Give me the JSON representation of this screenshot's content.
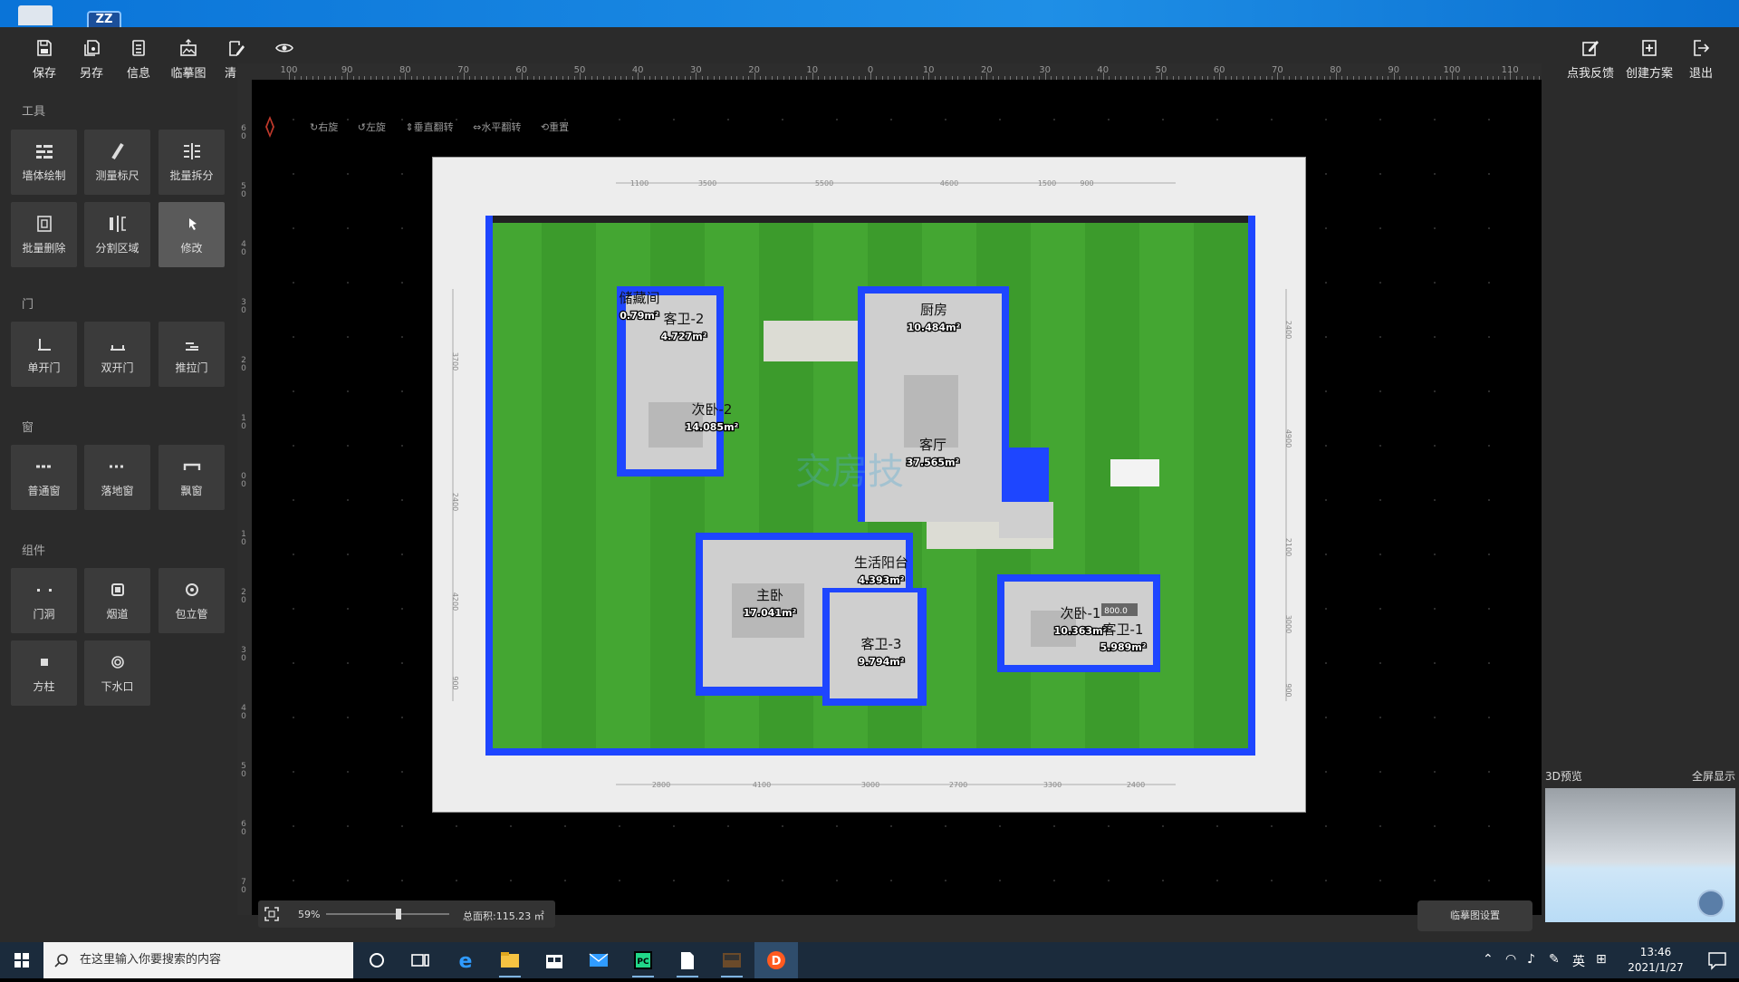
{
  "titlebar": {
    "app_icon_text": "ZZ"
  },
  "toolbar": {
    "left": [
      {
        "label": "保存",
        "icon": "save-icon"
      },
      {
        "label": "另存",
        "icon": "save-as-icon"
      },
      {
        "label": "信息",
        "icon": "info-icon"
      },
      {
        "label": "临摹图",
        "icon": "trace-image-icon"
      },
      {
        "label": "清空",
        "icon": "clear-icon"
      },
      {
        "label": "显示",
        "icon": "eye-icon"
      }
    ],
    "right": [
      {
        "label": "点我反馈",
        "icon": "feedback-icon"
      },
      {
        "label": "创建方案",
        "icon": "create-plan-icon"
      },
      {
        "label": "退出",
        "icon": "exit-icon"
      }
    ]
  },
  "sidebar": {
    "sections": [
      "工具",
      "门",
      "窗",
      "组件"
    ],
    "tools": [
      "墙体绘制",
      "测量标尺",
      "批量拆分",
      "批量删除",
      "分割区域",
      "修改"
    ],
    "doors": [
      "单开门",
      "双开门",
      "推拉门"
    ],
    "windows": [
      "普通窗",
      "落地窗",
      "飘窗"
    ],
    "components": [
      "门洞",
      "烟道",
      "包立管",
      "方柱",
      "下水口"
    ],
    "active_tool": "修改"
  },
  "ruler": {
    "h_labels": [
      "100",
      "90",
      "80",
      "70",
      "60",
      "50",
      "40",
      "30",
      "20",
      "10",
      "0",
      "10",
      "20",
      "30",
      "40",
      "50",
      "60",
      "70",
      "80",
      "90",
      "100",
      "110"
    ],
    "v_labels": [
      "6",
      "5",
      "4",
      "3",
      "2",
      "1",
      "0",
      "1",
      "2",
      "3",
      "4",
      "5",
      "6",
      "7"
    ]
  },
  "canvas_ops": [
    "右旋",
    "左旋",
    "垂直翻转",
    "水平翻转",
    "重置"
  ],
  "plan": {
    "top_dims": [
      "1100",
      "3500",
      "5500",
      "4600",
      "1500",
      "900"
    ],
    "bottom_dims": [
      "2800",
      "4100",
      "3000",
      "2700",
      "3300",
      "2400"
    ],
    "left_dims": [
      "3700",
      "2400",
      "4200",
      "900"
    ],
    "right_dims": [
      "2400",
      "4900",
      "2100",
      "3000",
      "900"
    ],
    "rooms": [
      {
        "name": "储藏间",
        "area": "0.79m²"
      },
      {
        "name": "客卫-2",
        "area": "4.727m²"
      },
      {
        "name": "次卧-2",
        "area": "14.085m²"
      },
      {
        "name": "厨房",
        "area": "10.484m²"
      },
      {
        "name": "客厅",
        "area": "37.565m²"
      },
      {
        "name": "生活阳台",
        "area": "4.393m²"
      },
      {
        "name": "主卧",
        "area": "17.041m²"
      },
      {
        "name": "客卫-3",
        "area": "9.794m²"
      },
      {
        "name": "次卧-1",
        "area": "10.363m²"
      },
      {
        "name": "客卫-1",
        "area": "5.989m²"
      }
    ],
    "measure_value": "800.0",
    "watermark": "交房技"
  },
  "bottom": {
    "zoom": "59%",
    "zoom_level": 0.59,
    "total_area": "总面积:115.23 ㎡",
    "settings_button": "临摹图设置"
  },
  "preview": {
    "title": "3D预览",
    "fullscreen": "全屏显示"
  },
  "taskbar": {
    "search_placeholder": "在这里输入你要搜索的内容",
    "ime": "英",
    "time": "13:46",
    "date": "2021/1/27"
  },
  "colors": {
    "accent": "#0a74d8",
    "wall": "#1e46ff",
    "grass": "#3a9a2a",
    "bg": "#2b2b2b"
  }
}
